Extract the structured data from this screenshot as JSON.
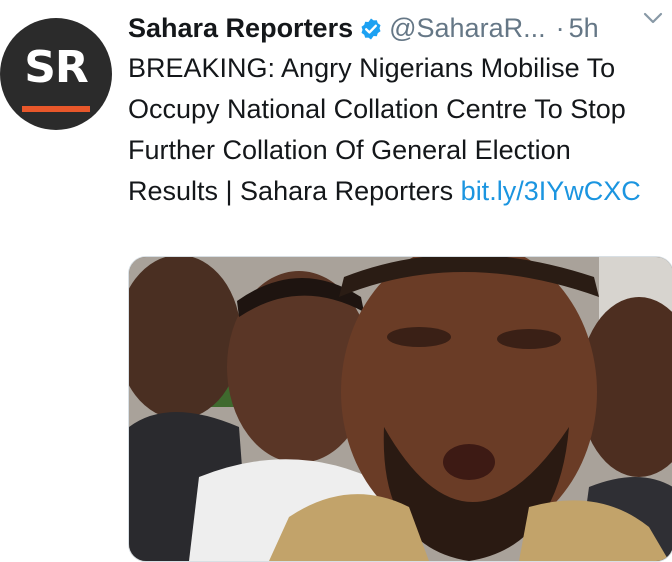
{
  "tweet": {
    "author_name": "Sahara Reporters",
    "handle": "@SaharaR...",
    "separator": "·",
    "time": "5h",
    "avatar_text": "SR",
    "text": "BREAKING: Angry Nigerians Mobilise To Occupy National Collation Centre To Stop Further Collation Of General Election Results | Sahara Reporters ",
    "link_text": "bit.ly/3IYwCXC"
  },
  "icons": {
    "verified": "verified-badge-icon",
    "more": "chevron-down-icon"
  },
  "colors": {
    "link": "#1b95e0",
    "verified": "#1da1f2",
    "secondary_text": "#657786",
    "avatar_bg": "#2b2b2b",
    "avatar_accent": "#e8572a"
  }
}
